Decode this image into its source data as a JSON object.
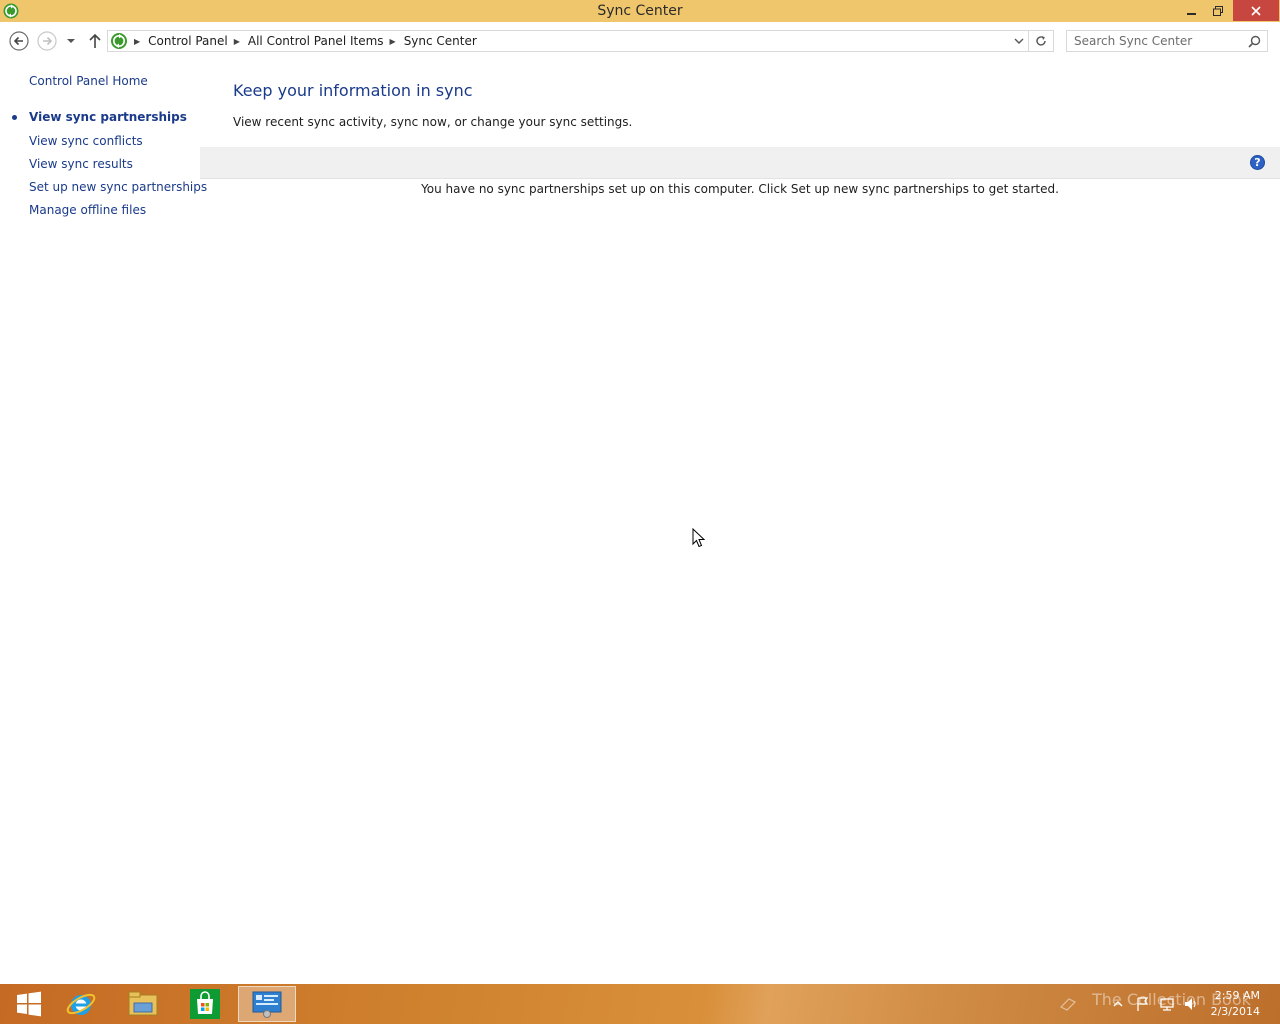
{
  "window": {
    "title": "Sync Center",
    "controls": {
      "minimize": "minimize",
      "maximize": "restore",
      "close": "close"
    }
  },
  "address_bar": {
    "breadcrumbs": [
      "Control Panel",
      "All Control Panel Items",
      "Sync Center"
    ]
  },
  "search": {
    "placeholder": "Search Sync Center"
  },
  "left_nav": {
    "home": "Control Panel Home",
    "items": [
      {
        "label": "View sync partnerships",
        "active": true
      },
      {
        "label": "View sync conflicts",
        "active": false
      },
      {
        "label": "View sync results",
        "active": false
      },
      {
        "label": "Set up new sync partnerships",
        "active": false
      },
      {
        "label": "Manage offline files",
        "active": false
      }
    ]
  },
  "main": {
    "title": "Keep your information in sync",
    "description": "View recent sync activity, sync now, or change your sync settings.",
    "help_label": "?",
    "empty_message": "You have no sync partnerships set up on this computer. Click Set up new sync partnerships to get started."
  },
  "taskbar": {
    "pinned": [
      "start-icon",
      "internet-explorer-icon",
      "file-explorer-icon",
      "store-icon",
      "control-panel-icon"
    ],
    "watermark": "The Collection Book",
    "clock_time": "2:59 AM",
    "clock_date": "2/3/2014"
  },
  "colors": {
    "titlebar": "#efc66c",
    "close": "#c7463f",
    "link": "#1a3a8a",
    "toolbar": "#f0f0f0",
    "taskbar": "#d0832f"
  }
}
